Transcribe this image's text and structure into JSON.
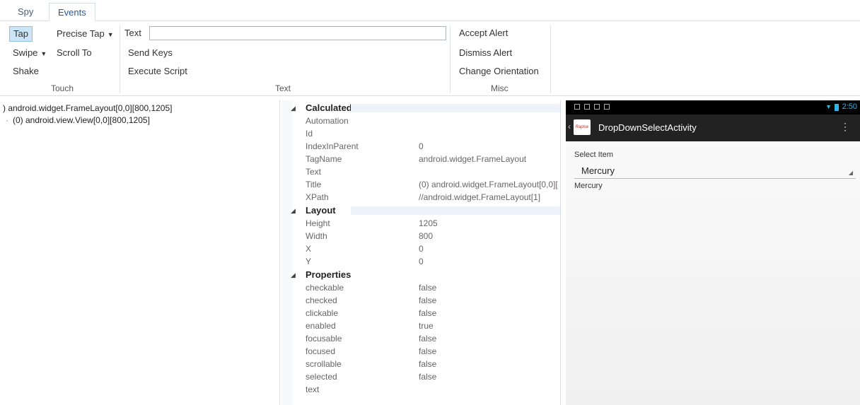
{
  "tabs": {
    "spy": "Spy",
    "events": "Events"
  },
  "ribbon": {
    "touch": {
      "tap": "Tap",
      "precise_tap": "Precise Tap",
      "swipe": "Swipe",
      "scroll_to": "Scroll To",
      "shake": "Shake",
      "group": "Touch"
    },
    "text": {
      "label": "Text",
      "input_value": "",
      "send_keys": "Send Keys",
      "execute_script": "Execute Script",
      "group": "Text"
    },
    "misc": {
      "accept_alert": "Accept Alert",
      "dismiss_alert": "Dismiss Alert",
      "change_orientation": "Change Orientation",
      "group": "Misc"
    }
  },
  "tree": {
    "items": [
      ") android.widget.FrameLayout[0,0][800,1205]",
      "(0) android.view.View[0,0][800,1205]"
    ]
  },
  "properties": {
    "calculated": {
      "label": "Calculated",
      "rows": [
        {
          "name": "Automation",
          "value": ""
        },
        {
          "name": "Id",
          "value": ""
        },
        {
          "name": "IndexInParent",
          "value": "0"
        },
        {
          "name": "TagName",
          "value": "android.widget.FrameLayout"
        },
        {
          "name": "Text",
          "value": ""
        },
        {
          "name": "Title",
          "value": "(0) android.widget.FrameLayout[0,0]["
        },
        {
          "name": "XPath",
          "value": "//android.widget.FrameLayout[1]"
        }
      ]
    },
    "layout": {
      "label": "Layout",
      "rows": [
        {
          "name": "Height",
          "value": "1205"
        },
        {
          "name": "Width",
          "value": "800"
        },
        {
          "name": "X",
          "value": "0"
        },
        {
          "name": "Y",
          "value": "0"
        }
      ]
    },
    "props": {
      "label": "Properties",
      "rows": [
        {
          "name": "checkable",
          "value": "false"
        },
        {
          "name": "checked",
          "value": "false"
        },
        {
          "name": "clickable",
          "value": "false"
        },
        {
          "name": "enabled",
          "value": "true"
        },
        {
          "name": "focusable",
          "value": "false"
        },
        {
          "name": "focused",
          "value": "false"
        },
        {
          "name": "scrollable",
          "value": "false"
        },
        {
          "name": "selected",
          "value": "false"
        },
        {
          "name": "text",
          "value": ""
        }
      ]
    }
  },
  "device": {
    "time": "2:50",
    "logo_text": "Rapise",
    "activity_title": "DropDownSelectActivity",
    "select_label": "Select Item",
    "spinner_value": "Mercury",
    "selected_text": "Mercury"
  }
}
